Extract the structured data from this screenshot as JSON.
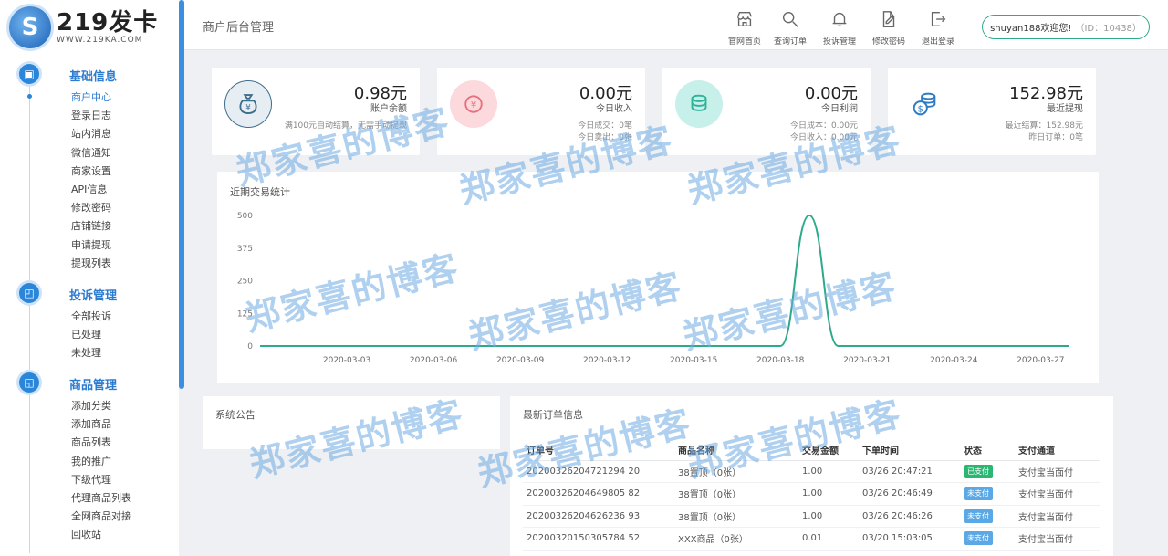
{
  "brand": {
    "logo_char": "S",
    "name": "219发卡",
    "domain": "WWW.219KA.COM"
  },
  "header": {
    "title": "商户后台管理",
    "buttons": [
      {
        "label": "官网首页",
        "icon": "shop-icon"
      },
      {
        "label": "查询订单",
        "icon": "search-icon"
      },
      {
        "label": "投诉管理",
        "icon": "bell-icon"
      },
      {
        "label": "修改密码",
        "icon": "edit-icon"
      },
      {
        "label": "退出登录",
        "icon": "logout-icon"
      }
    ],
    "welcome": "shuyan188欢迎您!",
    "user_id": "（ID：10438）"
  },
  "sidebar": {
    "groups": [
      {
        "title": "基础信息",
        "icon": "info-icon",
        "items": [
          "商户中心",
          "登录日志",
          "站内消息",
          "微信通知",
          "商家设置",
          "API信息",
          "修改密码",
          "店铺链接",
          "申请提现",
          "提现列表"
        ]
      },
      {
        "title": "投诉管理",
        "icon": "complaint-icon",
        "items": [
          "全部投诉",
          "已处理",
          "未处理"
        ]
      },
      {
        "title": "商品管理",
        "icon": "goods-icon",
        "items": [
          "添加分类",
          "添加商品",
          "商品列表",
          "我的推广",
          "下级代理",
          "代理商品列表",
          "全网商品对接",
          "回收站"
        ]
      }
    ],
    "active_item": "商户中心"
  },
  "stats": [
    {
      "value": "0.98元",
      "label": "账户余额",
      "sub": [
        "满100元自动结算，无需手动提现"
      ],
      "icon": "money-bag-icon",
      "icon_bg": "#e7eef3",
      "icon_color": "#3d6e8c"
    },
    {
      "value": "0.00元",
      "label": "今日收入",
      "sub": [
        "今日成交：0笔",
        "今日卖出：0张"
      ],
      "icon": "income-icon",
      "icon_bg": "#fbd9dc",
      "icon_color": "#e8707c"
    },
    {
      "value": "0.00元",
      "label": "今日利润",
      "sub": [
        "今日成本：0.00元",
        "今日收入：0.00元"
      ],
      "icon": "coins-icon",
      "icon_bg": "#c8f0ea",
      "icon_color": "#2db39a"
    },
    {
      "value": "152.98元",
      "label": "最近提现",
      "sub": [
        "最近结算：152.98元",
        "昨日订单：0笔"
      ],
      "icon": "coin-stack-icon",
      "icon_bg": "#ffffff",
      "icon_color": "#2e7cc6"
    }
  ],
  "chart_data": {
    "type": "line",
    "title": "近期交易统计",
    "x": [
      "2020-02-29",
      "2020-03-01",
      "2020-03-02",
      "2020-03-03",
      "2020-03-04",
      "2020-03-05",
      "2020-03-06",
      "2020-03-07",
      "2020-03-08",
      "2020-03-09",
      "2020-03-10",
      "2020-03-11",
      "2020-03-12",
      "2020-03-13",
      "2020-03-14",
      "2020-03-15",
      "2020-03-16",
      "2020-03-17",
      "2020-03-18",
      "2020-03-19",
      "2020-03-20",
      "2020-03-21",
      "2020-03-22",
      "2020-03-23",
      "2020-03-24",
      "2020-03-25",
      "2020-03-26",
      "2020-03-27",
      "2020-03-28"
    ],
    "xticks": [
      "2020-03-03",
      "2020-03-06",
      "2020-03-09",
      "2020-03-12",
      "2020-03-15",
      "2020-03-18",
      "2020-03-21",
      "2020-03-24",
      "2020-03-27"
    ],
    "series": [
      {
        "values": [
          0,
          0,
          0,
          0,
          0,
          0,
          0,
          0,
          0,
          0,
          0,
          0,
          0,
          0,
          0,
          0,
          0,
          0,
          0,
          500,
          0,
          0,
          0,
          0,
          0,
          0,
          0,
          0,
          0
        ]
      }
    ],
    "yticks": [
      0,
      125,
      250,
      375,
      500
    ],
    "ylim": [
      0,
      500
    ],
    "grid": false,
    "line_color": "#2eaa8a"
  },
  "notice": {
    "title": "系统公告"
  },
  "orders": {
    "title": "最新订单信息",
    "columns": [
      "订单号",
      "商品名称",
      "交易金额",
      "下单时间",
      "状态",
      "支付通道"
    ],
    "rows": [
      [
        "20200326204721294 20",
        "38置顶（0张）",
        "1.00",
        "03/26 20:47:21",
        "已支付",
        "支付宝当面付"
      ],
      [
        "20200326204649805 82",
        "38置顶（0张）",
        "1.00",
        "03/26 20:46:49",
        "未支付",
        "支付宝当面付"
      ],
      [
        "20200326204626236 93",
        "38置顶（0张）",
        "1.00",
        "03/26 20:46:26",
        "未支付",
        "支付宝当面付"
      ],
      [
        "20200320150305784 52",
        "XXX商品（0张）",
        "0.01",
        "03/20 15:03:05",
        "未支付",
        "支付宝当面付"
      ]
    ],
    "status_colors": {
      "已支付": "#2bb673",
      "未支付": "#5aa9e6"
    }
  },
  "watermark": "郑家喜的博客"
}
